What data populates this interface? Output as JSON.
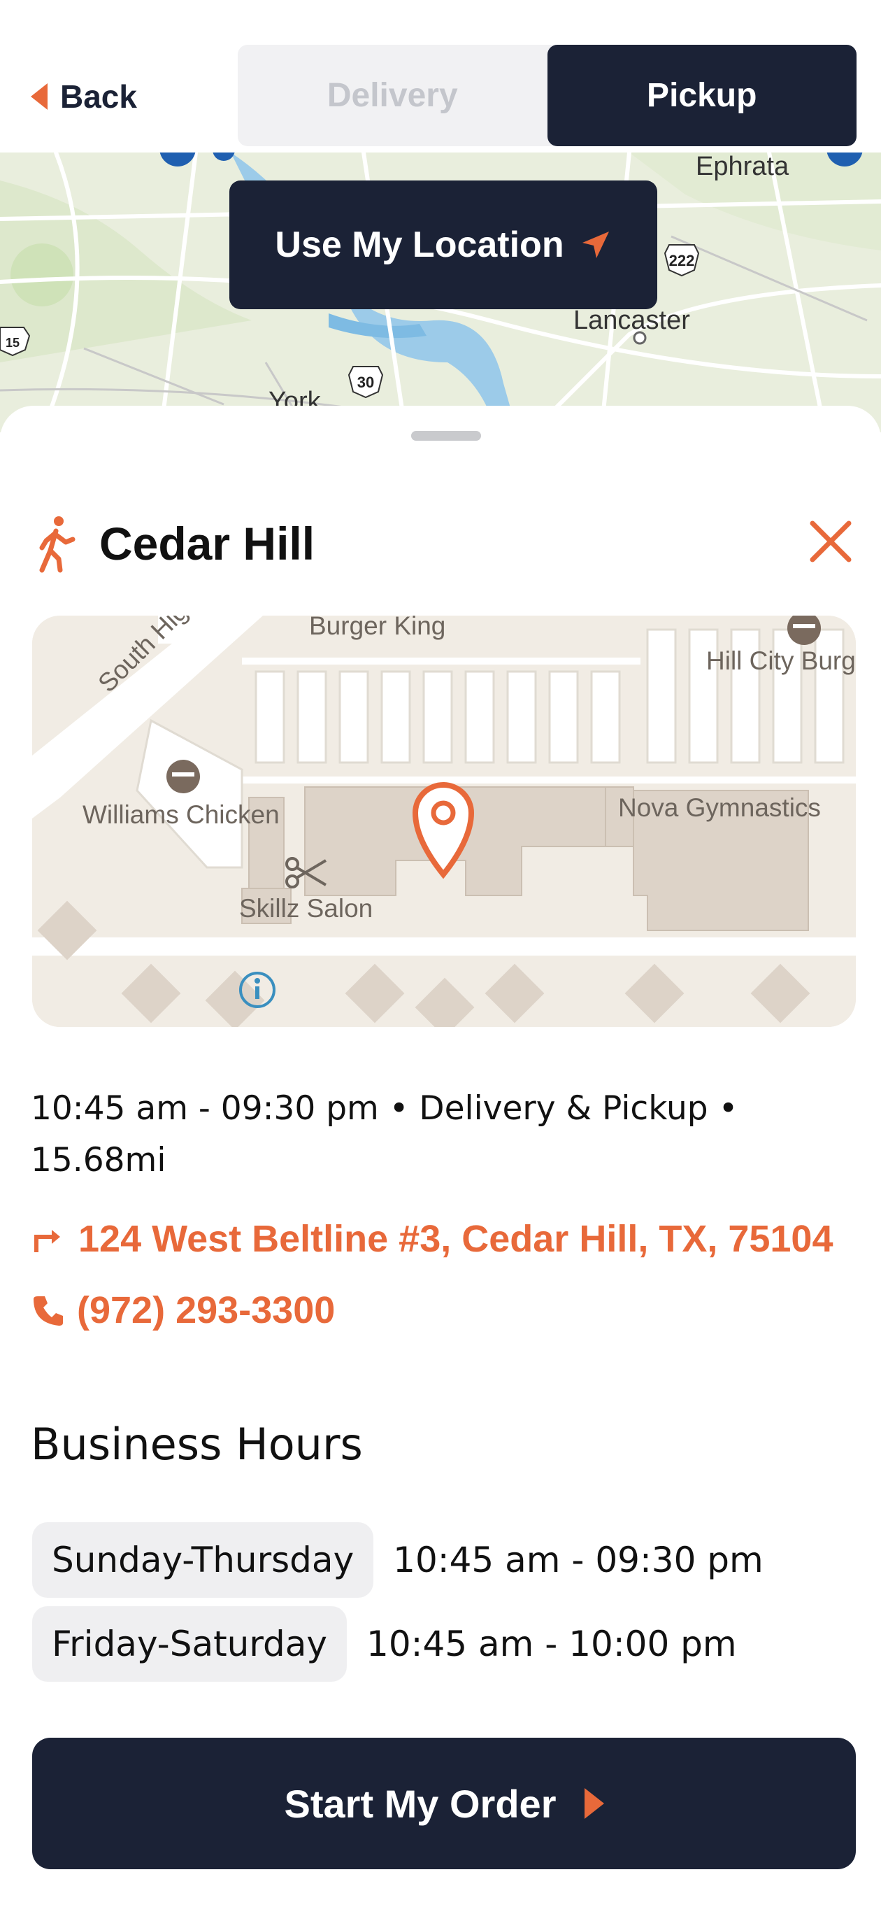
{
  "header": {
    "back_label": "Back",
    "mode_tabs": [
      {
        "label": "Delivery",
        "selected": false
      },
      {
        "label": "Pickup",
        "selected": true
      }
    ]
  },
  "region_map": {
    "use_location_label": "Use My Location",
    "labels": {
      "ephrata": "Ephrata",
      "lancaster": "Lancaster",
      "york": "York"
    },
    "shields": {
      "route_30": "30",
      "route_222": "222",
      "route_15": "15"
    }
  },
  "store": {
    "name": "Cedar Hill",
    "map_places": {
      "burger_king": "Burger King",
      "hill_city": "Hill City Burg",
      "williams_chicken": "Williams Chicken",
      "nova_gymnastics": "Nova Gymnastics",
      "skillz_salon": "Skillz Salon",
      "road_south": "South Higl"
    },
    "info_line": "10:45 am - 09:30 pm • Delivery & Pickup • 15.68mi",
    "address": "124 West Beltline #3, Cedar Hill, TX, 75104",
    "phone": "(972) 293-3300"
  },
  "business_hours": {
    "title": "Business Hours",
    "rows": [
      {
        "days": "Sunday-Thursday",
        "time": "10:45 am - 09:30 pm"
      },
      {
        "days": "Friday-Saturday",
        "time": "10:45 am - 10:00 pm"
      }
    ]
  },
  "cta": {
    "label": "Start My Order"
  },
  "colors": {
    "navy": "#1b2236",
    "accent": "#e8693a",
    "map_green": "#e9eedd",
    "map_water": "#4f9fd6"
  }
}
